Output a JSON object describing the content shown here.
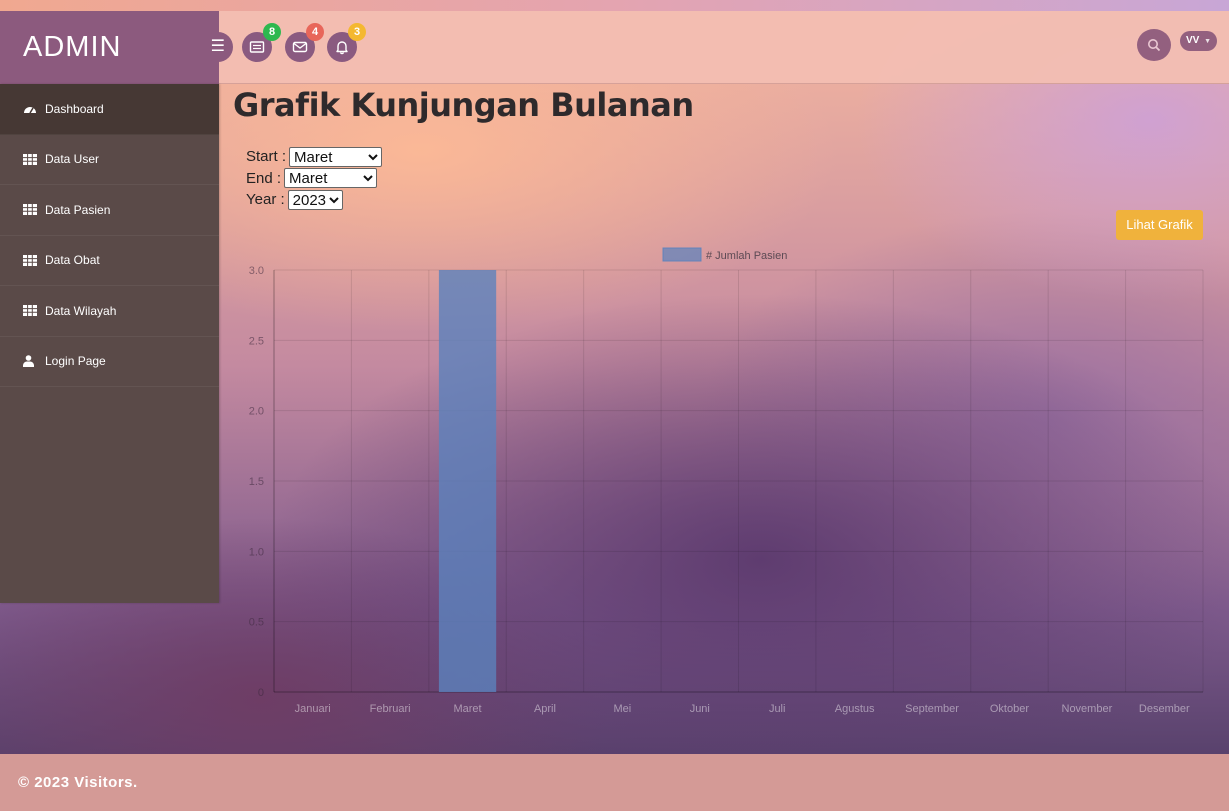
{
  "brand": {
    "title": "ADMIN"
  },
  "topbar": {
    "badges": {
      "tasks": "8",
      "messages": "4",
      "alerts": "3"
    },
    "user": "VV",
    "badge_colors": {
      "tasks": "#2eb84f",
      "messages": "#e8665a",
      "alerts": "#f4b830"
    }
  },
  "sidebar": {
    "items": [
      {
        "label": "Dashboard",
        "icon": "dashboard-icon"
      },
      {
        "label": "Data User",
        "icon": "table-icon"
      },
      {
        "label": "Data Pasien",
        "icon": "table-icon"
      },
      {
        "label": "Data Obat",
        "icon": "table-icon"
      },
      {
        "label": "Data Wilayah",
        "icon": "table-icon"
      },
      {
        "label": "Login Page",
        "icon": "user-icon"
      }
    ]
  },
  "main": {
    "title": "Grafik Kunjungan Bulanan",
    "filters": {
      "start_label": "Start :",
      "start_value": "Maret",
      "end_label": "End :",
      "end_value": "Maret",
      "year_label": "Year :",
      "year_value": "2023"
    },
    "button_label": "Lihat Grafik"
  },
  "chart_data": {
    "type": "bar",
    "categories": [
      "Januari",
      "Februari",
      "Maret",
      "April",
      "Mei",
      "Juni",
      "Juli",
      "Agustus",
      "September",
      "Oktober",
      "November",
      "Desember"
    ],
    "series": [
      {
        "name": "# Jumlah Pasien",
        "values": [
          0,
          0,
          3,
          0,
          0,
          0,
          0,
          0,
          0,
          0,
          0,
          0
        ],
        "color": "#5b82bd"
      }
    ],
    "yticks": [
      "0",
      "0.5",
      "1.0",
      "1.5",
      "2.0",
      "2.5",
      "3.0"
    ],
    "ylim": [
      0,
      3
    ],
    "grid": true,
    "legend": "top"
  },
  "footer": {
    "text": "© 2023 Visitors."
  }
}
